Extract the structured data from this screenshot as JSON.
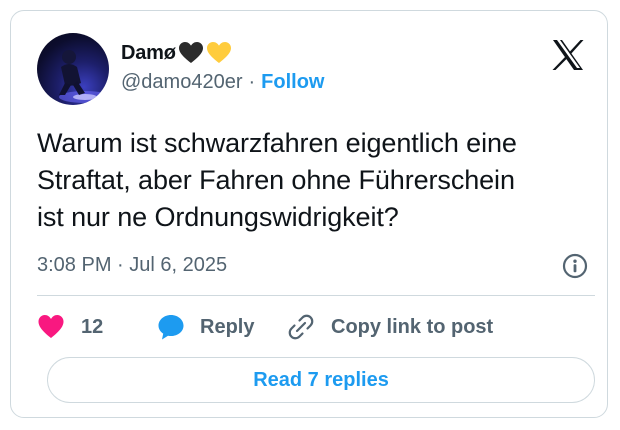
{
  "author": {
    "display_name": "Damø",
    "name_emojis": [
      "black-heart-icon",
      "yellow-heart-icon"
    ],
    "handle": "@damo420er",
    "separator": "·",
    "follow_label": "Follow"
  },
  "post": {
    "text": "Warum ist schwarzfahren eigentlich eine\nStraftat, aber Fahren ohne Führerschein\nist nur ne Ordnungswidrigkeit?",
    "timestamp": "3:08 PM · Jul 6, 2025"
  },
  "actions": {
    "like_count": "12",
    "reply_label": "Reply",
    "copy_link_label": "Copy link to post"
  },
  "footer": {
    "read_replies_label": "Read 7 replies"
  },
  "colors": {
    "accent": "#1d9bf0",
    "like": "#f91880",
    "secondary_text": "#536471",
    "border": "#cfd9de"
  },
  "icons": {
    "brand": "x-logo-icon",
    "info": "info-circle-icon",
    "like": "heart-icon",
    "reply": "speech-bubble-icon",
    "copy": "link-icon"
  }
}
